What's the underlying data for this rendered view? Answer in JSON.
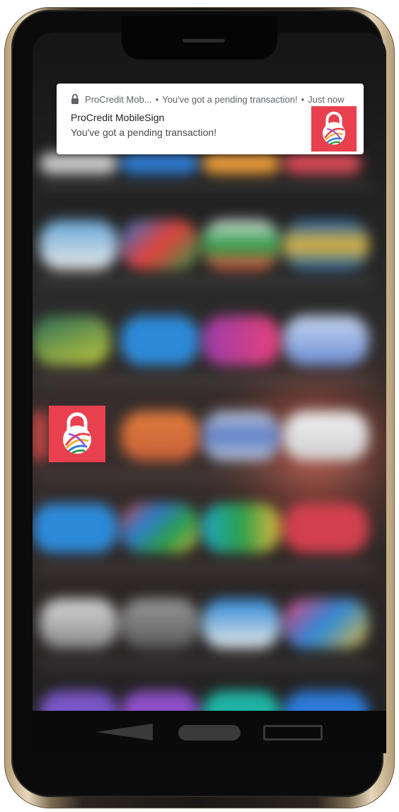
{
  "notification": {
    "app_name": "ProCredit Mob...",
    "header_message": "You've got a pending transaction!",
    "time": "Just now",
    "separator": "•",
    "title": "ProCredit MobileSign",
    "body": "You've got a pending transaction!"
  },
  "home_screen": {
    "highlighted_app": "lock-globe-icon"
  },
  "colors": {
    "brand_red": "#e8404f",
    "notification_bg": "#ffffff"
  },
  "icons": {
    "notification_small": "lock-icon",
    "navigation": [
      "back-icon",
      "home-icon",
      "recents-icon"
    ]
  }
}
